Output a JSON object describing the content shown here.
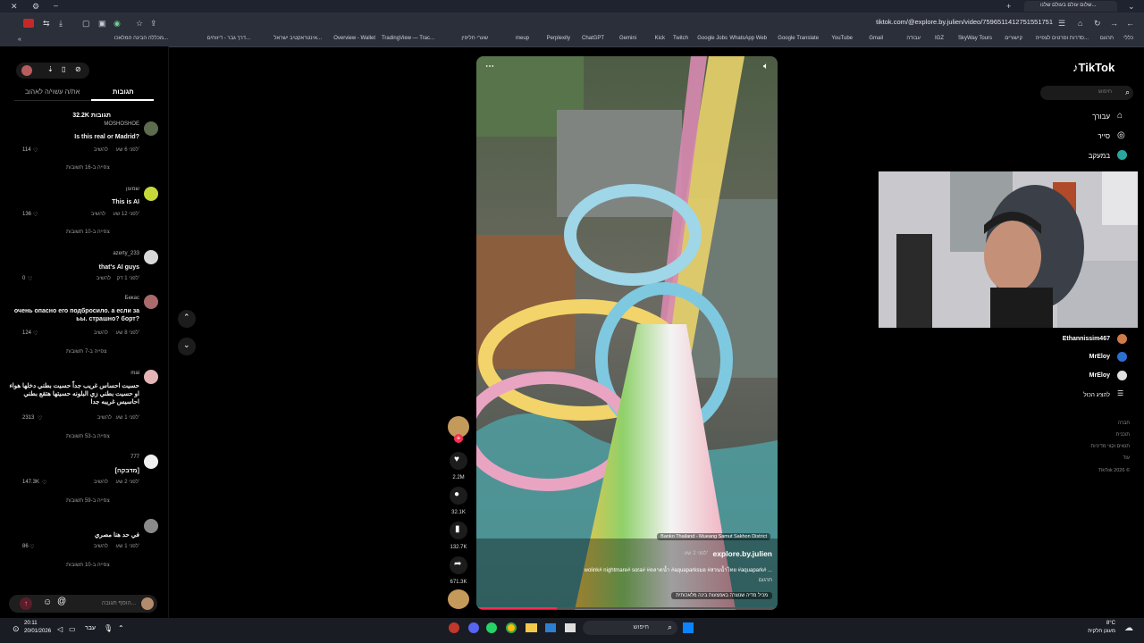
{
  "browser": {
    "url": "tiktok.com/@explore.by.julien/video/7596511412751551751",
    "tab_title": "שלום עולם בעולם שלנו..."
  },
  "bookmarks": [
    "כללי",
    "תרגום",
    "סדרות וסרטים לצפייה...",
    "קישורים",
    "SkyWay Tours",
    "IGZ",
    "עבודה",
    "Gmail",
    "YouTube",
    "Google Translate",
    "WhatsApp Web",
    "Google Jobs",
    "Twitch",
    "Kick",
    "Gemini",
    "ChatGPT",
    "Perplexity",
    "meup",
    "שערי חליפין",
    "TradingView — Trac...",
    "Overview - Wallet",
    "אינטראקטיב ישראל...",
    "דרך גבר - דיווחים...",
    "מכללה הבינה המלאכו..."
  ],
  "left_panel": {
    "tabs": [
      "תגובות",
      "את/ה עשוי/ה לאהוב"
    ],
    "comments_count": "32.2K תגובות",
    "comments": [
      {
        "user": "MOSHOSHOE",
        "text": "Is this real or Madrid?",
        "time": "לפני 6 שע'",
        "reply": "להשיב",
        "likes": "114",
        "replies": "צפייה ב-16 תשובות"
      },
      {
        "user": "שמעון",
        "text": "This is AI",
        "time": "לפני 12 שע'",
        "reply": "להשיב",
        "likes": "136",
        "replies": "צפייה ב-10 תשובות"
      },
      {
        "user": "azerty_233",
        "text": "that's AI guys",
        "time": "לפני 1 דק'",
        "reply": "להשיב",
        "likes": "0",
        "replies": ""
      },
      {
        "user": "Бекас",
        "text": "очень опасно его подбросило. а если за ьы. страшно? борт?",
        "time": "לפני 8 שע'",
        "reply": "להשיב",
        "likes": "124",
        "replies": "צפייה ב-7 תשובות"
      },
      {
        "user": "mai",
        "text": "حسيت احساس غريب جداً حسيت بطني دخلها هواء او حسيت بطني زي البلونه حسيتها هتقع بطني احاسيس غريبه جدا",
        "time": "לפני 1 שע'",
        "reply": "להשיב",
        "likes": "2313",
        "replies": "צפייה ב-53 תשובות"
      },
      {
        "user": "777",
        "text": "[מדבקה]",
        "time": "לפני 2 שע'",
        "reply": "להשיב",
        "likes": "147.3K",
        "replies": "צפייה ב-59 תשובות"
      },
      {
        "user": "",
        "text": "في حد هنا مصري",
        "time": "לפני 1 שע'",
        "reply": "להשיב",
        "likes": "86",
        "replies": "צפייה ב-10 תשובות"
      }
    ],
    "comment_placeholder": "הוסף תגובה..."
  },
  "video": {
    "location": "Banko Thailand - Mueang Samut Sakhon District",
    "author": "explore.by.julien",
    "posted": "לפני 2 שע'",
    "caption": "wolink# nightmare# sora# #ตลาดน้ำ #aquaparksมอ #สวนน้ำไทย #aquapark# ...",
    "translate": "תרגום",
    "ai_label": "מכיל מדיה שנוצרה באמצעות בינה מלאכותית"
  },
  "actions": {
    "likes": "2.2M",
    "comments": "32.1K",
    "saves": "132.7K",
    "shares": "671.3K"
  },
  "sidebar": {
    "logo": "TikTok",
    "search_placeholder": "חיפוש",
    "nav": [
      "עבורך",
      "סייר",
      "במעקב"
    ],
    "following": [
      "Ethannissim467",
      "MrEloy",
      "MrEloy"
    ],
    "show_all": "להציג הכול",
    "footer": [
      "חברה",
      "תוכנית",
      "תנאים וקווי מדיניות",
      "עוד",
      "TikTok 2026 ©"
    ]
  },
  "taskbar": {
    "time": "20:11",
    "date": "20/01/2026",
    "lang": "עבר",
    "search": "חיפוש",
    "weather_temp": "8°C",
    "weather_desc": "מעונן חלקית"
  },
  "colors": {
    "accent": "#fe2c55",
    "panel": "#000000",
    "chrome": "#2b2f3a"
  }
}
